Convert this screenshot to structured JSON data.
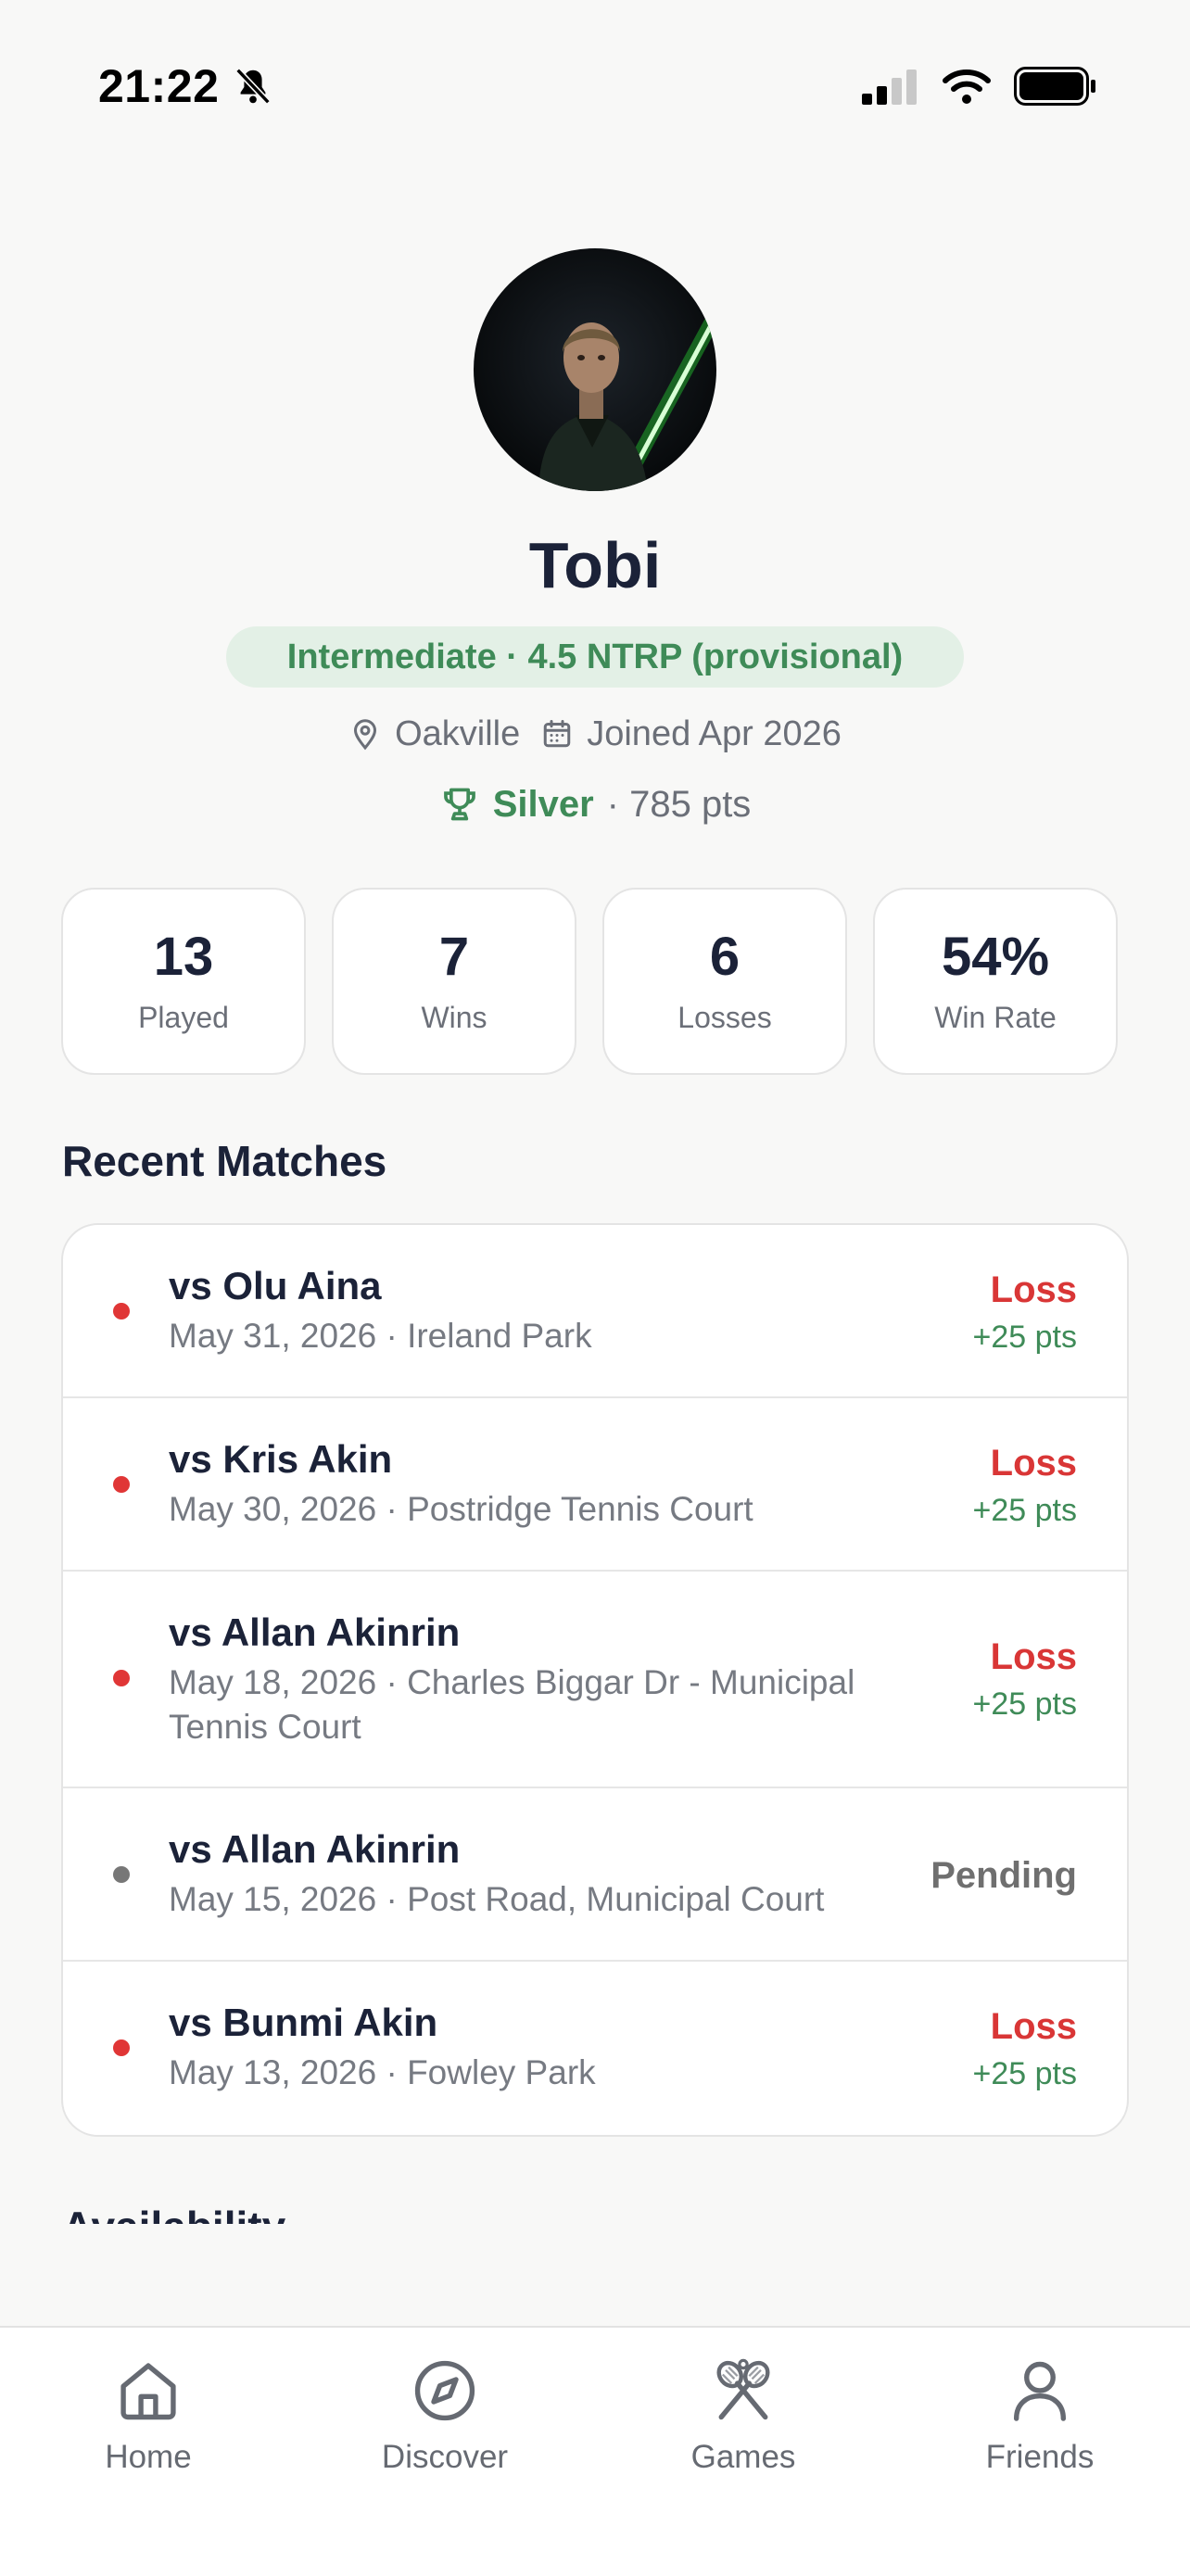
{
  "status_bar": {
    "time": "21:22"
  },
  "profile": {
    "name": "Tobi",
    "level_badge": "Intermediate · 4.5 NTRP (provisional)",
    "location": "Oakville",
    "joined": "Joined Apr 2026",
    "rank": "Silver",
    "rank_points": "· 785 pts"
  },
  "stats": [
    {
      "value": "13",
      "label": "Played"
    },
    {
      "value": "7",
      "label": "Wins"
    },
    {
      "value": "6",
      "label": "Losses"
    },
    {
      "value": "54%",
      "label": "Win Rate"
    }
  ],
  "recent_matches": {
    "title": "Recent Matches",
    "items": [
      {
        "opponent": "vs Olu Aina",
        "details": "May 31, 2026 · Ireland Park",
        "result": "Loss",
        "points": "+25 pts",
        "status_color": "#e03636"
      },
      {
        "opponent": "vs Kris Akin",
        "details": "May 30, 2026 · Postridge Tennis Court",
        "result": "Loss",
        "points": "+25 pts",
        "status_color": "#e03636"
      },
      {
        "opponent": "vs Allan Akinrin",
        "details": "May 18, 2026 · Charles Biggar Dr - Municipal Tennis Court",
        "result": "Loss",
        "points": "+25 pts",
        "status_color": "#e03636"
      },
      {
        "opponent": "vs Allan Akinrin",
        "details": "May 15, 2026 · Post Road, Municipal Court",
        "result": "Pending",
        "points": "",
        "status_color": "#777777"
      },
      {
        "opponent": "vs Bunmi Akin",
        "details": "May 13, 2026 · Fowley Park",
        "result": "Loss",
        "points": "+25 pts",
        "status_color": "#e03636"
      }
    ]
  },
  "availability": {
    "title": "Availability"
  },
  "tab_bar": {
    "home": "Home",
    "discover": "Discover",
    "games": "Games",
    "friends": "Friends"
  },
  "colors": {
    "accent_green": "#3f8b58",
    "loss_red": "#d93636",
    "pending_gray": "#6f6f6f",
    "badge_bg": "#e3f0e6"
  },
  "icons": [
    "bell-slash-icon",
    "cellular-signal-icon",
    "wifi-icon",
    "battery-icon",
    "location-pin-icon",
    "calendar-icon",
    "trophy-icon",
    "home-icon",
    "compass-icon",
    "tennis-rackets-icon",
    "person-icon"
  ]
}
